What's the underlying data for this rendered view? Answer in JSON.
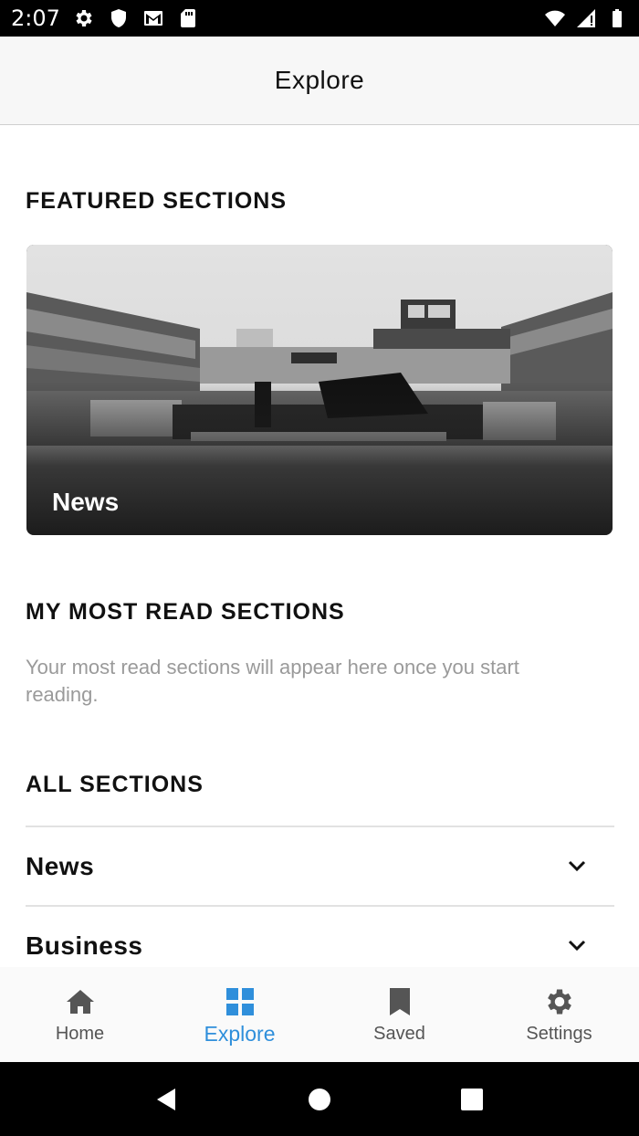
{
  "status_bar": {
    "time": "2:07",
    "left_icons": [
      "gear-icon",
      "shield-icon",
      "gmail-icon",
      "sd-card-icon"
    ],
    "right_icons": [
      "wifi-icon",
      "signal-icon",
      "battery-icon"
    ]
  },
  "app_bar": {
    "title": "Explore"
  },
  "featured": {
    "heading": "FEATURED SECTIONS",
    "cards": [
      {
        "label": "News",
        "image": "stadium-orchestra-photo"
      }
    ]
  },
  "most_read": {
    "heading": "MY MOST READ SECTIONS",
    "empty_message": "Your most read sections will appear here once you start reading."
  },
  "all_sections": {
    "heading": "ALL SECTIONS",
    "items": [
      {
        "label": "News",
        "icon": "chevron-down-icon"
      },
      {
        "label": "Business",
        "icon": "chevron-down-icon"
      }
    ]
  },
  "bottom_nav": {
    "active": "Explore",
    "active_color": "#2f8fdb",
    "items": [
      {
        "label": "Home",
        "icon": "home-icon"
      },
      {
        "label": "Explore",
        "icon": "grid-icon"
      },
      {
        "label": "Saved",
        "icon": "bookmark-icon"
      },
      {
        "label": "Settings",
        "icon": "gear-icon"
      }
    ]
  },
  "system_nav": {
    "buttons": [
      "back-icon",
      "home-circle-icon",
      "recents-icon"
    ]
  }
}
